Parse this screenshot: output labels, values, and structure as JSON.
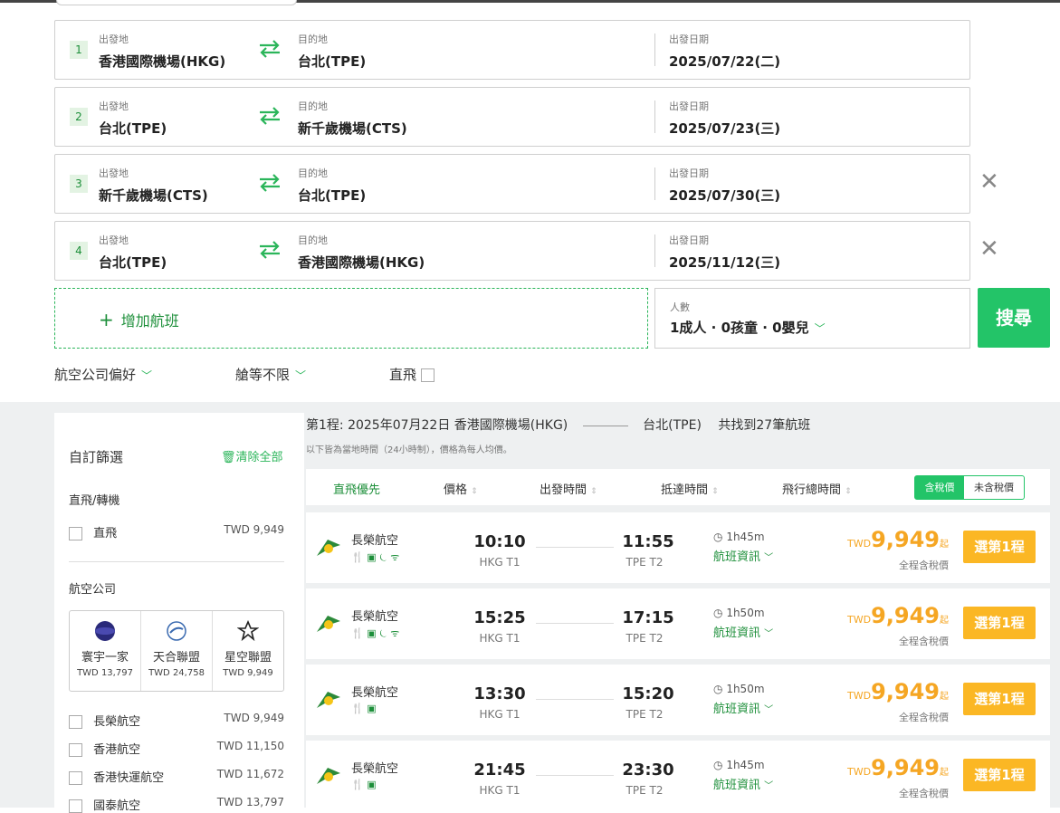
{
  "segments": [
    {
      "num": "1",
      "from_label": "出發地",
      "from": "香港國際機場(HKG)",
      "to_label": "目的地",
      "to": "台北(TPE)",
      "date_label": "出發日期",
      "date": "2025/07/22(二)"
    },
    {
      "num": "2",
      "from_label": "出發地",
      "from": "台北(TPE)",
      "to_label": "目的地",
      "to": "新千歲機場(CTS)",
      "date_label": "出發日期",
      "date": "2025/07/23(三)"
    },
    {
      "num": "3",
      "from_label": "出發地",
      "from": "新千歲機場(CTS)",
      "to_label": "目的地",
      "to": "台北(TPE)",
      "date_label": "出發日期",
      "date": "2025/07/30(三)"
    },
    {
      "num": "4",
      "from_label": "出發地",
      "from": "台北(TPE)",
      "to_label": "目的地",
      "to": "香港國際機場(HKG)",
      "date_label": "出發日期",
      "date": "2025/11/12(三)"
    }
  ],
  "add_flight": "增加航班",
  "passengers": {
    "label": "人數",
    "value": "1成人 · 0孩童 · 0嬰兒"
  },
  "search": "搜尋",
  "options": {
    "airline_pref": "航空公司偏好",
    "cabin": "艙等不限",
    "direct": "直飛"
  },
  "sidebar": {
    "title": "自訂篩選",
    "clear": "清除全部",
    "direct_section": "直飛/轉機",
    "direct_item": {
      "label": "直飛",
      "price": "TWD 9,949"
    },
    "airline_section": "航空公司",
    "alliances": [
      {
        "name": "寰宇一家",
        "price": "TWD 13,797"
      },
      {
        "name": "天合聯盟",
        "price": "TWD 24,758"
      },
      {
        "name": "星空聯盟",
        "price": "TWD 9,949"
      }
    ],
    "airlines": [
      {
        "name": "長榮航空",
        "price": "TWD 9,949"
      },
      {
        "name": "香港航空",
        "price": "TWD 11,150"
      },
      {
        "name": "香港快運航空",
        "price": "TWD 11,672"
      },
      {
        "name": "國泰航空",
        "price": "TWD 13,797"
      }
    ]
  },
  "leg": {
    "prefix": "第1程: 2025年07月22日 香港國際機場(HKG)",
    "dest": "台北(TPE)",
    "found": "共找到27筆航班",
    "note": "以下皆為當地時間（24小時制），價格為每人均價。"
  },
  "sort": {
    "direct_first": "直飛優先",
    "price": "價格",
    "depart": "出發時間",
    "arrive": "抵達時間",
    "duration": "飛行總時間",
    "tax_incl": "含稅價",
    "tax_excl": "未含稅價"
  },
  "flights": [
    {
      "airline": "長榮航空",
      "dep": "10:10",
      "dep_term": "HKG T1",
      "arr": "11:55",
      "arr_term": "TPE T2",
      "duration": "1h45m",
      "info": "航班資訊",
      "currency": "TWD",
      "price": "9,949",
      "qi": "起",
      "tax_note": "全程含稅價",
      "select": "選第1程",
      "amenities": "🍴 ▣ ⏾ ᯤ"
    },
    {
      "airline": "長榮航空",
      "dep": "15:25",
      "dep_term": "HKG T1",
      "arr": "17:15",
      "arr_term": "TPE T2",
      "duration": "1h50m",
      "info": "航班資訊",
      "currency": "TWD",
      "price": "9,949",
      "qi": "起",
      "tax_note": "全程含稅價",
      "select": "選第1程",
      "amenities": "🍴 ▣ ⏾ ᯤ"
    },
    {
      "airline": "長榮航空",
      "dep": "13:30",
      "dep_term": "HKG T1",
      "arr": "15:20",
      "arr_term": "TPE T2",
      "duration": "1h50m",
      "info": "航班資訊",
      "currency": "TWD",
      "price": "9,949",
      "qi": "起",
      "tax_note": "全程含稅價",
      "select": "選第1程",
      "amenities": "🍴 ▣"
    },
    {
      "airline": "長榮航空",
      "dep": "21:45",
      "dep_term": "HKG T1",
      "arr": "23:30",
      "arr_term": "TPE T2",
      "duration": "1h45m",
      "info": "航班資訊",
      "currency": "TWD",
      "price": "9,949",
      "qi": "起",
      "tax_note": "全程含稅價",
      "select": "選第1程",
      "amenities": "🍴 ▣"
    }
  ],
  "colors": {
    "accent": "#23c468",
    "price": "#f5a623",
    "select": "#fbb724"
  }
}
